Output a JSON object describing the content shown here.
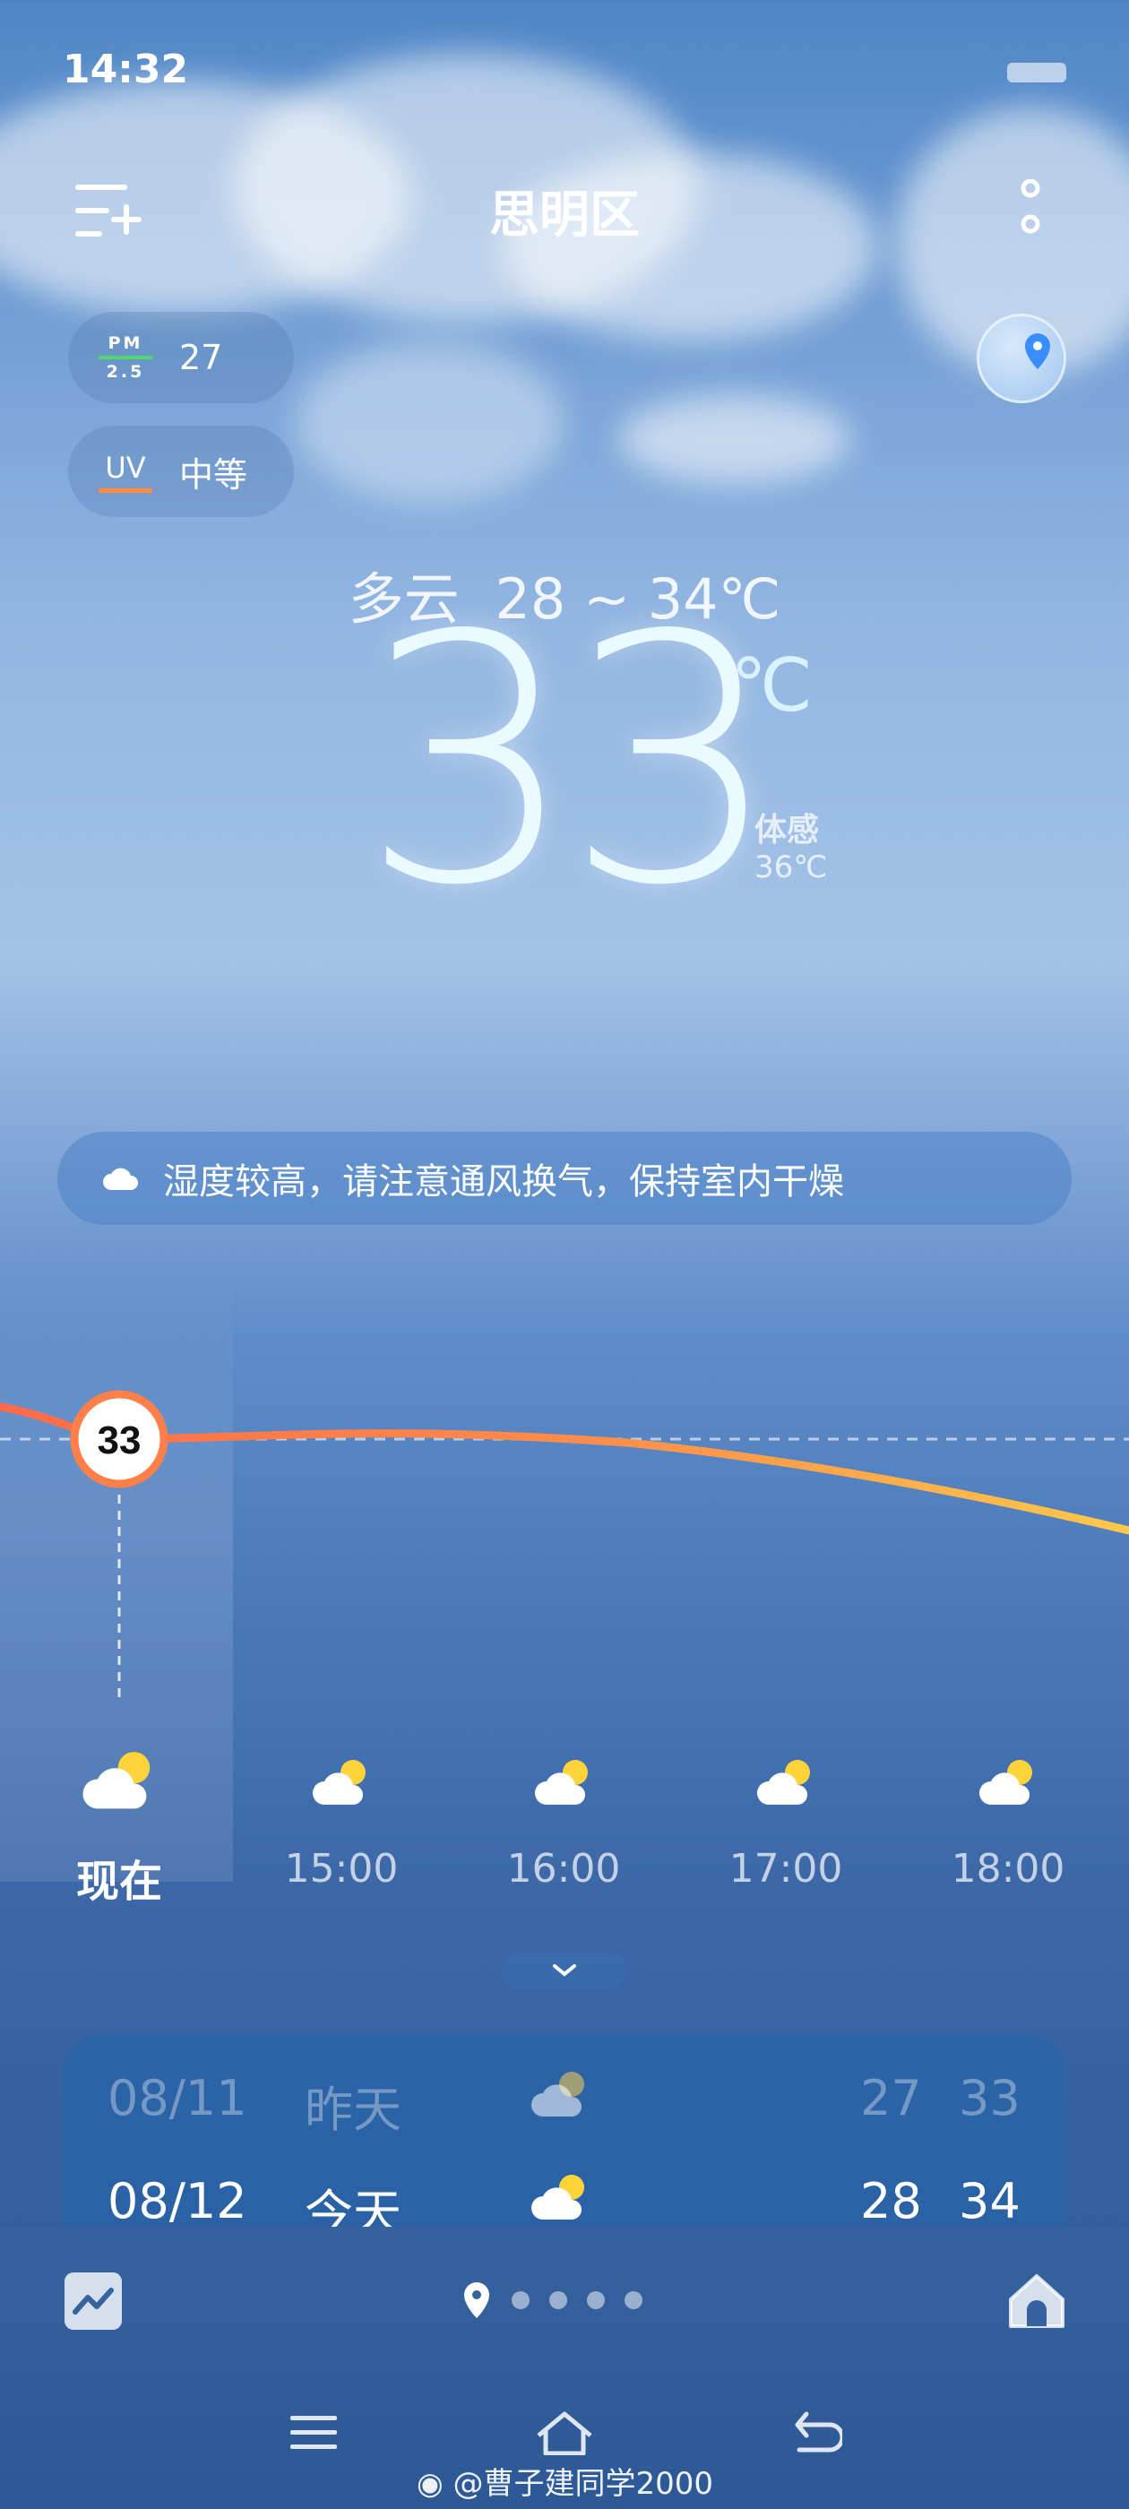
{
  "status_bar": {
    "time": "14:32"
  },
  "header": {
    "city": "思明区"
  },
  "air": {
    "pm_label_top": "PM",
    "pm_label_bottom": "2.5",
    "pm_value": "27",
    "uv_label": "UV",
    "uv_value": "中等"
  },
  "current": {
    "condition": "多云",
    "range": "28 ~ 34℃",
    "temp": "33",
    "unit": "℃",
    "feels_label": "体感",
    "feels_value": "36℃"
  },
  "tip": {
    "text": "湿度较高，请注意通风换气，保持室内干燥",
    "icon": "cloud-icon"
  },
  "hourly": {
    "current_temp": "33",
    "items": [
      {
        "label": "现在",
        "icon": "partly-cloudy-icon"
      },
      {
        "label": "15:00",
        "icon": "partly-cloudy-icon"
      },
      {
        "label": "16:00",
        "icon": "partly-cloudy-icon"
      },
      {
        "label": "17:00",
        "icon": "partly-cloudy-icon"
      },
      {
        "label": "18:00",
        "icon": "partly-cloudy-icon"
      }
    ]
  },
  "daily": [
    {
      "date": "08/11",
      "name": "昨天",
      "icon": "partly-cloudy-icon",
      "low": "27",
      "high": "33"
    },
    {
      "date": "08/12",
      "name": "今天",
      "icon": "partly-cloudy-icon",
      "low": "28",
      "high": "34"
    }
  ],
  "pager": {
    "count": 5,
    "active": 0
  },
  "watermark": "@曹子建同学2000",
  "colors": {
    "curve_start": "#ff6b4a",
    "curve_end": "#ffc94a",
    "pm_bar": "#4cd964",
    "uv_bar": "#ff8c3a"
  }
}
